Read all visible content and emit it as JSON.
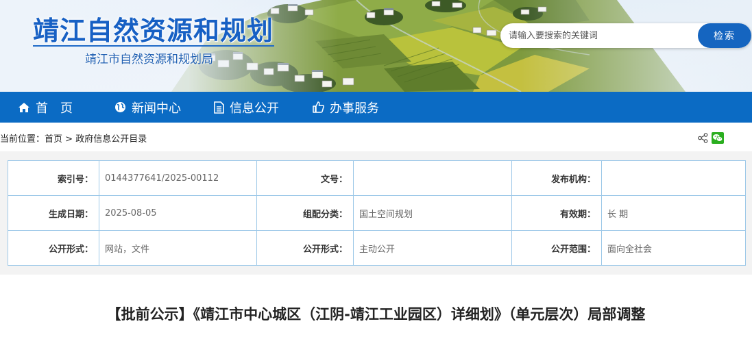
{
  "header": {
    "site_title": "靖江自然资源和规划",
    "site_subtitle": "靖江市自然资源和规划局",
    "search_placeholder": "请输入要搜索的关键词",
    "search_button": "检索"
  },
  "nav": {
    "home": "首页",
    "news": "新闻中心",
    "info": "信息公开",
    "service": "办事服务"
  },
  "breadcrumb": {
    "prefix": "当前位置：",
    "home": "首页",
    "separator": ">",
    "current": "政府信息公开目录"
  },
  "meta": {
    "rows": [
      [
        {
          "label": "索引号：",
          "value": "0144377641/2025-00112"
        },
        {
          "label": "文号：",
          "value": ""
        },
        {
          "label": "发布机构：",
          "value": ""
        }
      ],
      [
        {
          "label": "生成日期：",
          "value": "2025-08-05"
        },
        {
          "label": "组配分类：",
          "value": "国土空间规划"
        },
        {
          "label": "有效期：",
          "value": "长 期"
        }
      ],
      [
        {
          "label": "公开形式：",
          "value": "网站，文件"
        },
        {
          "label": "公开形式：",
          "value": "主动公开"
        },
        {
          "label": "公开范围：",
          "value": "面向全社会"
        }
      ]
    ]
  },
  "article": {
    "title": "【批前公示】《靖江市中心城区（江阴-靖江工业园区）详细划》（单元层次）局部调整"
  },
  "colors": {
    "nav_bg": "#0b6bc4",
    "search_button": "#1565c0",
    "title_blue": "#1760c4",
    "table_border": "#9dc8e8",
    "wechat_green": "#2aae1f"
  },
  "icons": {
    "home": "home-icon",
    "news": "globe-icon",
    "info": "document-icon",
    "service": "thumbs-up-icon",
    "share": "share-icon",
    "wechat": "wechat-icon"
  }
}
